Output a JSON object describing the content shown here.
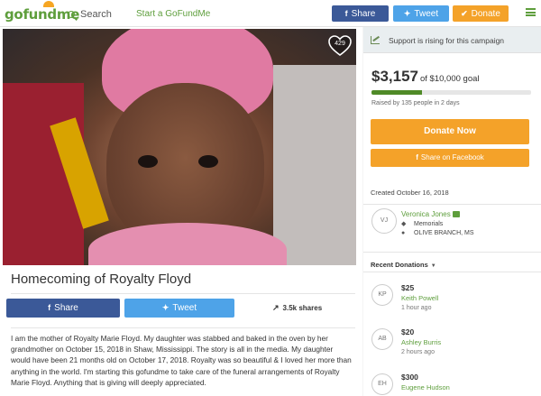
{
  "nav": {
    "logo": "gofundme",
    "search_label": "Search",
    "start_label": "Start a GoFundMe",
    "share_label": "Share",
    "tweet_label": "Tweet",
    "donate_label": "Donate"
  },
  "campaign": {
    "heart_count": "429",
    "title": "Homecoming of Royalty Floyd",
    "share_label": "Share",
    "tweet_label": "Tweet",
    "shares": "3.5k shares",
    "story": "I am the mother of Royalty Marie Floyd. My daughter was stabbed and baked in the oven by her grandmother on October 15, 2018 in Shaw, Mississippi. The story is all in the media. My daughter would have been 21 months old on October 17, 2018. Royalty was so beautiful & I loved her more than anything in the world. I'm starting this gofundme to take care of the funeral arrangements of Royalty Marie Floyd. Anything that is giving will deeply appreciated."
  },
  "sidebar": {
    "rising": "Support is rising for this campaign",
    "raised": "$3,157",
    "goal": "of $10,000 goal",
    "progress_fraction": 0.3157,
    "raised_by": "Raised by 135 people in 2 days",
    "donate_now": "Donate Now",
    "share_facebook": "Share on Facebook",
    "created": "Created October 16, 2018",
    "organizer": {
      "initials": "VJ",
      "name": "Veronica Jones",
      "category": "Memorials",
      "location": "OLIVE BRANCH, MS"
    },
    "recent_label": "Recent Donations",
    "donations": [
      {
        "initials": "KP",
        "amount": "$25",
        "name": "Keith Powell",
        "time": "1 hour ago"
      },
      {
        "initials": "AB",
        "amount": "$20",
        "name": "Ashley Burris",
        "time": "2 hours ago"
      },
      {
        "initials": "EH",
        "amount": "$300",
        "name": "Eugene Hudson",
        "time": ""
      }
    ]
  },
  "colors": {
    "brand_green": "#5e9e3c",
    "facebook_blue": "#3b5998",
    "twitter_blue": "#4ea3e8",
    "donate_orange": "#f4a229",
    "progress_green": "#4f8a27"
  }
}
